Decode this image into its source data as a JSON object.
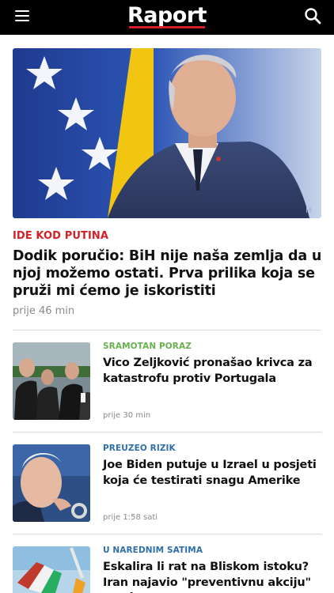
{
  "header": {
    "logo_text": "Raport",
    "menu_icon": "hamburger-menu-icon",
    "search_icon": "search-icon",
    "brand_color": "#d42027"
  },
  "hero": {
    "kicker": "IDE KOD PUTINA",
    "title": "Dodik poručio: BiH nije naša zemlja da u njoj možemo ostati. Prva prilika koja se pruži mi ćemo je iskoristiti",
    "time": "prije 46 min"
  },
  "articles": [
    {
      "kicker": "SRAMOTAN PORAZ",
      "kicker_color": "#6ab04c",
      "title": "Vico Zeljković pronašao krivca za katastrofu protiv Portugala",
      "time": "prije 30 min"
    },
    {
      "kicker": "PREUZEO RIZIK",
      "kicker_color": "#2f6fa8",
      "title": "Joe Biden putuje u Izrael u posjeti koja će testirati snagu Amerike",
      "time": "prije 1:58 sati"
    },
    {
      "kicker": "U NAREDNIM SATIMA",
      "kicker_color": "#2f6fa8",
      "title": "Eskalira li rat na Bliskom istoku? Iran najavio \"preventivnu akciju\" protiv",
      "time": ""
    }
  ]
}
